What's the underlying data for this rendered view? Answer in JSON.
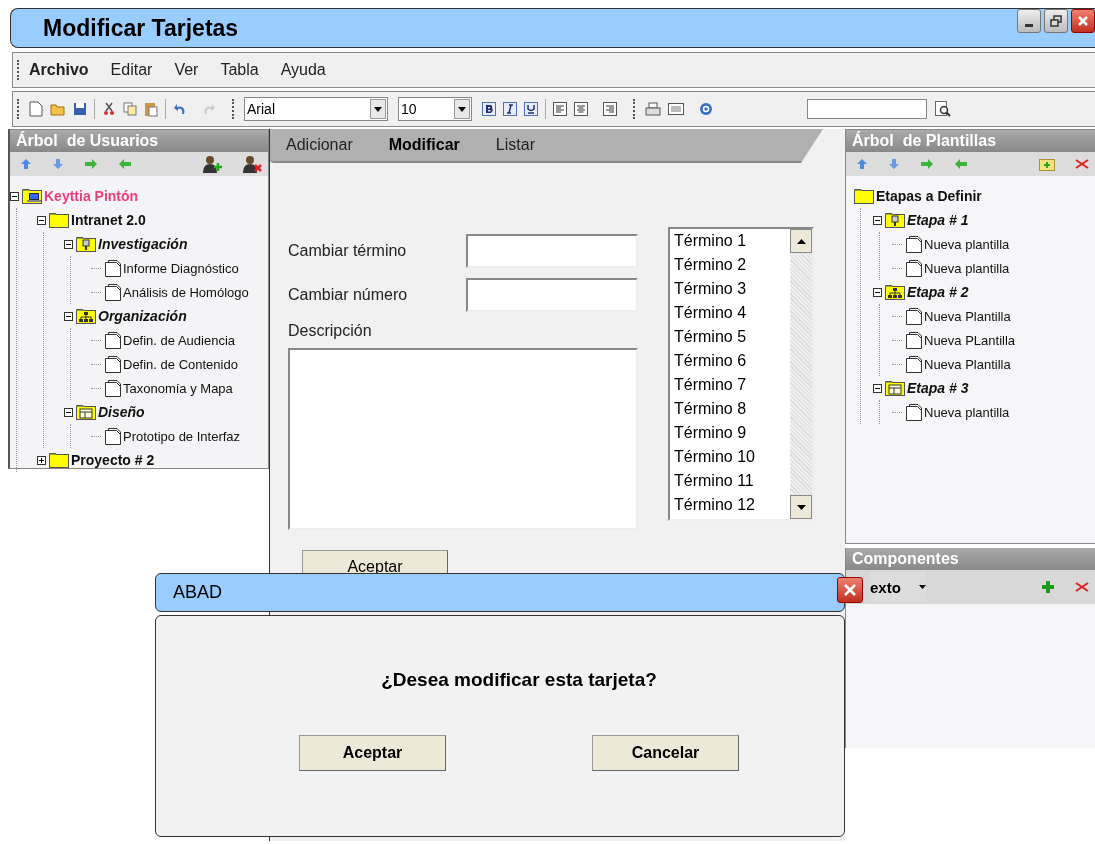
{
  "window": {
    "title": "Modificar Tarjetas"
  },
  "menu": [
    {
      "label": "Archivo",
      "selected": true
    },
    {
      "label": "Editar",
      "selected": false
    },
    {
      "label": "Ver",
      "selected": false
    },
    {
      "label": "Tabla",
      "selected": false
    },
    {
      "label": "Ayuda",
      "selected": false
    }
  ],
  "toolbar": {
    "font": "Arial",
    "size": "10"
  },
  "user_tree": {
    "title": "Árbol  de Usuarios",
    "nodes": [
      {
        "label": "Keyttia Pintón",
        "kind": "user",
        "expanded": true,
        "children": [
          {
            "label": "Intranet 2.0",
            "kind": "project",
            "expanded": true,
            "children": [
              {
                "label": "Investigación",
                "kind": "stage",
                "expanded": true,
                "children": [
                  {
                    "label": "Informe Diagnóstico",
                    "kind": "doc"
                  },
                  {
                    "label": "Análisis de Homólogo",
                    "kind": "doc"
                  }
                ]
              },
              {
                "label": "Organización",
                "kind": "stage",
                "expanded": true,
                "children": [
                  {
                    "label": "Defin. de Audiencia",
                    "kind": "doc"
                  },
                  {
                    "label": "Defin. de Contenido",
                    "kind": "doc"
                  },
                  {
                    "label": "Taxonomía y Mapa",
                    "kind": "doc"
                  }
                ]
              },
              {
                "label": "Diseño",
                "kind": "stage",
                "expanded": true,
                "children": [
                  {
                    "label": "Prototipo de Interfaz",
                    "kind": "doc"
                  }
                ]
              }
            ]
          },
          {
            "label": "Proyecto # 2",
            "kind": "project",
            "expanded": false
          }
        ]
      }
    ]
  },
  "tabs": [
    {
      "label": "Adicionar",
      "selected": false
    },
    {
      "label": "Modificar",
      "selected": true
    },
    {
      "label": "Listar",
      "selected": false
    }
  ],
  "form": {
    "term_label": "Cambiar término",
    "number_label": "Cambiar número",
    "description_label": "Descripción",
    "accept": "Aceptar",
    "terms": [
      "Término 1",
      "Término 2",
      "Término 3",
      "Término 4",
      "Término 5",
      "Término 6",
      "Término 7",
      "Término 8",
      "Término 9",
      "Término 10",
      "Término 11",
      "Término 12"
    ]
  },
  "template_tree": {
    "title": "Árbol  de Plantillas",
    "nodes": [
      {
        "label": "Etapas a Definir",
        "kind": "root",
        "children": [
          {
            "label": "Etapa # 1",
            "kind": "stage",
            "expanded": true,
            "children": [
              {
                "label": "Nueva plantilla",
                "kind": "doc"
              },
              {
                "label": "Nueva plantilla",
                "kind": "doc"
              }
            ]
          },
          {
            "label": "Etapa # 2",
            "kind": "stage",
            "expanded": true,
            "children": [
              {
                "label": "Nueva Plantilla",
                "kind": "doc"
              },
              {
                "label": "Nueva PLantilla",
                "kind": "doc"
              },
              {
                "label": "Nueva Plantilla",
                "kind": "doc"
              }
            ]
          },
          {
            "label": "Etapa # 3",
            "kind": "stage",
            "expanded": true,
            "children": [
              {
                "label": "Nueva plantilla",
                "kind": "doc"
              }
            ]
          }
        ]
      }
    ]
  },
  "components": {
    "title": "Componentes",
    "type": "exto"
  },
  "dialog": {
    "title": "ABAD",
    "message": "¿Desea modificar esta tarjeta?",
    "buttons": [
      "Aceptar",
      "Cancelar"
    ]
  }
}
